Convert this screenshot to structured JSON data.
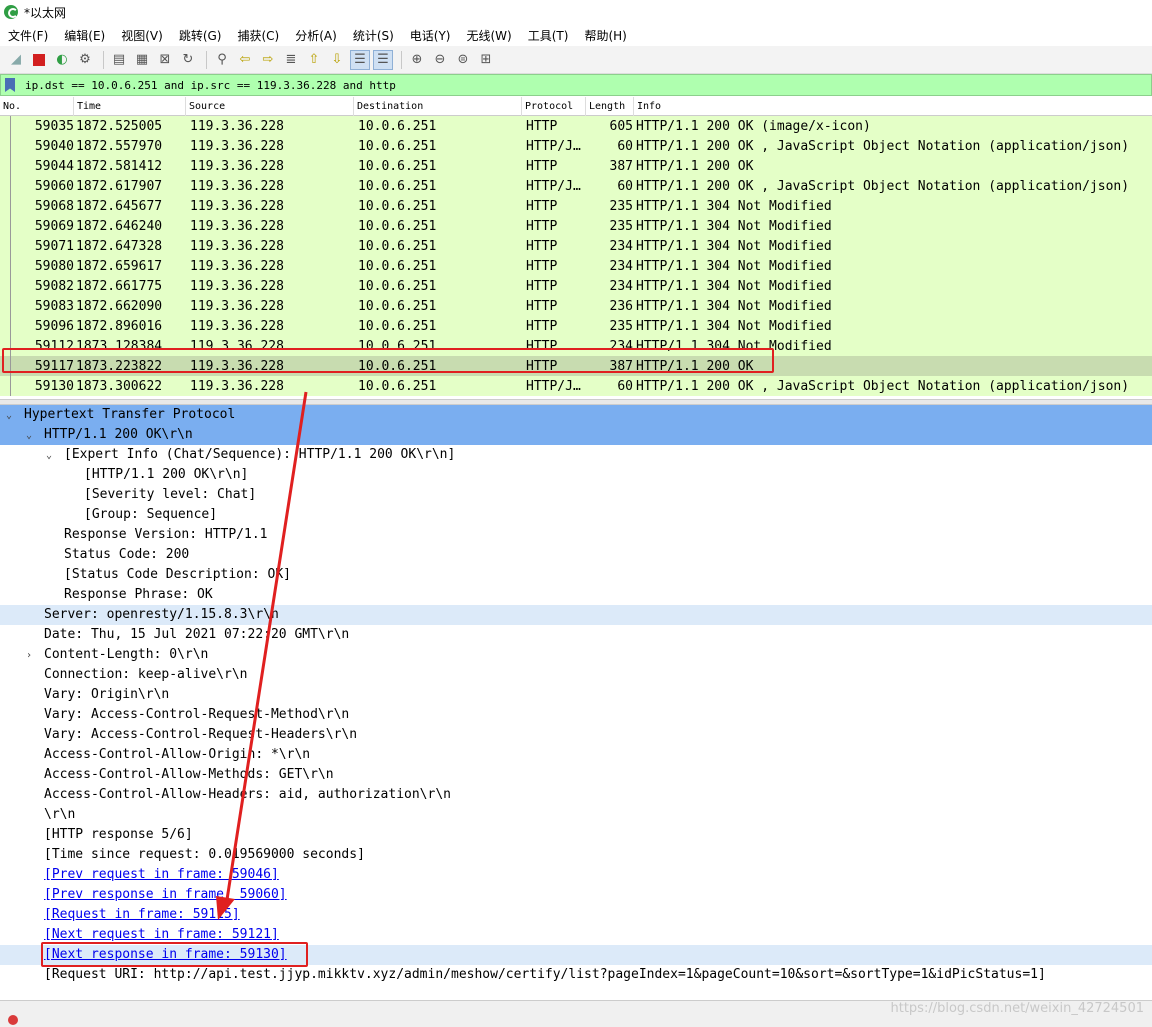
{
  "window": {
    "title": "*以太网"
  },
  "menu": [
    "文件(F)",
    "编辑(E)",
    "视图(V)",
    "跳转(G)",
    "捕获(C)",
    "分析(A)",
    "统计(S)",
    "电话(Y)",
    "无线(W)",
    "工具(T)",
    "帮助(H)"
  ],
  "toolbar": {
    "buttons": [
      "shark-fin-icon",
      "stop-icon",
      "restart-icon",
      "options-icon",
      "open-icon",
      "save-icon",
      "close-file-icon",
      "reload-icon",
      "find-icon",
      "back-icon",
      "forward-icon",
      "goto-icon",
      "first-icon",
      "last-icon",
      "autoscroll-icon",
      "colorize-icon",
      "zoom-in-icon",
      "zoom-out-icon",
      "zoom-normal-icon",
      "resize-columns-icon"
    ]
  },
  "filter": {
    "text": "ip.dst == 10.0.6.251 and ip.src == 119.3.36.228 and  http"
  },
  "packet_list": {
    "columns": [
      "No.",
      "Time",
      "Source",
      "Destination",
      "Protocol",
      "Length",
      "Info"
    ],
    "rows": [
      {
        "no": "59035",
        "time": "1872.525005",
        "src": "119.3.36.228",
        "dst": "10.0.6.251",
        "proto": "HTTP",
        "len": "605",
        "info": "HTTP/1.1 200 OK  (image/x-icon)"
      },
      {
        "no": "59040",
        "time": "1872.557970",
        "src": "119.3.36.228",
        "dst": "10.0.6.251",
        "proto": "HTTP/J…",
        "len": "60",
        "info": "HTTP/1.1 200 OK , JavaScript Object Notation (application/json)"
      },
      {
        "no": "59044",
        "time": "1872.581412",
        "src": "119.3.36.228",
        "dst": "10.0.6.251",
        "proto": "HTTP",
        "len": "387",
        "info": "HTTP/1.1 200 OK"
      },
      {
        "no": "59060",
        "time": "1872.617907",
        "src": "119.3.36.228",
        "dst": "10.0.6.251",
        "proto": "HTTP/J…",
        "len": "60",
        "info": "HTTP/1.1 200 OK , JavaScript Object Notation (application/json)"
      },
      {
        "no": "59068",
        "time": "1872.645677",
        "src": "119.3.36.228",
        "dst": "10.0.6.251",
        "proto": "HTTP",
        "len": "235",
        "info": "HTTP/1.1 304 Not Modified"
      },
      {
        "no": "59069",
        "time": "1872.646240",
        "src": "119.3.36.228",
        "dst": "10.0.6.251",
        "proto": "HTTP",
        "len": "235",
        "info": "HTTP/1.1 304 Not Modified"
      },
      {
        "no": "59071",
        "time": "1872.647328",
        "src": "119.3.36.228",
        "dst": "10.0.6.251",
        "proto": "HTTP",
        "len": "234",
        "info": "HTTP/1.1 304 Not Modified"
      },
      {
        "no": "59080",
        "time": "1872.659617",
        "src": "119.3.36.228",
        "dst": "10.0.6.251",
        "proto": "HTTP",
        "len": "234",
        "info": "HTTP/1.1 304 Not Modified"
      },
      {
        "no": "59082",
        "time": "1872.661775",
        "src": "119.3.36.228",
        "dst": "10.0.6.251",
        "proto": "HTTP",
        "len": "234",
        "info": "HTTP/1.1 304 Not Modified"
      },
      {
        "no": "59083",
        "time": "1872.662090",
        "src": "119.3.36.228",
        "dst": "10.0.6.251",
        "proto": "HTTP",
        "len": "236",
        "info": "HTTP/1.1 304 Not Modified"
      },
      {
        "no": "59096",
        "time": "1872.896016",
        "src": "119.3.36.228",
        "dst": "10.0.6.251",
        "proto": "HTTP",
        "len": "235",
        "info": "HTTP/1.1 304 Not Modified"
      },
      {
        "no": "59112",
        "time": "1873.128384",
        "src": "119.3.36.228",
        "dst": "10.0.6.251",
        "proto": "HTTP",
        "len": "234",
        "info": "HTTP/1.1 304 Not Modified"
      },
      {
        "no": "59117",
        "time": "1873.223822",
        "src": "119.3.36.228",
        "dst": "10.0.6.251",
        "proto": "HTTP",
        "len": "387",
        "info": "HTTP/1.1 200 OK"
      },
      {
        "no": "59130",
        "time": "1873.300622",
        "src": "119.3.36.228",
        "dst": "10.0.6.251",
        "proto": "HTTP/J…",
        "len": "60",
        "info": "HTTP/1.1 200 OK , JavaScript Object Notation (application/json)"
      }
    ]
  },
  "detail": {
    "lines": [
      {
        "text": "Hypertext Transfer Protocol",
        "chev": "v",
        "link": false
      },
      {
        "text": "HTTP/1.1 200 OK\\r\\n",
        "chev": "v",
        "link": false
      },
      {
        "text": "[Expert Info (Chat/Sequence): HTTP/1.1 200 OK\\r\\n]",
        "chev": "v",
        "link": false
      },
      {
        "text": "[HTTP/1.1 200 OK\\r\\n]",
        "chev": "",
        "link": false
      },
      {
        "text": "[Severity level: Chat]",
        "chev": "",
        "link": false
      },
      {
        "text": "[Group: Sequence]",
        "chev": "",
        "link": false
      },
      {
        "text": "Response Version: HTTP/1.1",
        "chev": "",
        "link": false
      },
      {
        "text": "Status Code: 200",
        "chev": "",
        "link": false
      },
      {
        "text": "[Status Code Description: OK]",
        "chev": "",
        "link": false
      },
      {
        "text": "Response Phrase: OK",
        "chev": "",
        "link": false
      },
      {
        "text": "Server: openresty/1.15.8.3\\r\\n",
        "chev": "",
        "link": false
      },
      {
        "text": "Date: Thu, 15 Jul 2021 07:22:20 GMT\\r\\n",
        "chev": "",
        "link": false
      },
      {
        "text": "Content-Length: 0\\r\\n",
        "chev": ">",
        "link": false
      },
      {
        "text": "Connection: keep-alive\\r\\n",
        "chev": "",
        "link": false
      },
      {
        "text": "Vary: Origin\\r\\n",
        "chev": "",
        "link": false
      },
      {
        "text": "Vary: Access-Control-Request-Method\\r\\n",
        "chev": "",
        "link": false
      },
      {
        "text": "Vary: Access-Control-Request-Headers\\r\\n",
        "chev": "",
        "link": false
      },
      {
        "text": "Access-Control-Allow-Origin: *\\r\\n",
        "chev": "",
        "link": false
      },
      {
        "text": "Access-Control-Allow-Methods: GET\\r\\n",
        "chev": "",
        "link": false
      },
      {
        "text": "Access-Control-Allow-Headers: aid, authorization\\r\\n",
        "chev": "",
        "link": false
      },
      {
        "text": "\\r\\n",
        "chev": "",
        "link": false
      },
      {
        "text": "[HTTP response 5/6]",
        "chev": "",
        "link": false
      },
      {
        "text": "[Time since request: 0.019569000 seconds]",
        "chev": "",
        "link": false
      },
      {
        "text": "[Prev request in frame: 59046]",
        "chev": "",
        "link": true
      },
      {
        "text": "[Prev response in frame: 59060]",
        "chev": "",
        "link": true
      },
      {
        "text": "[Request in frame: 59115]",
        "chev": "",
        "link": true
      },
      {
        "text": "[Next request in frame: 59121]",
        "chev": "",
        "link": true
      },
      {
        "text": "[Next response in frame: 59130]",
        "chev": "",
        "link": true
      },
      {
        "text": "[Request URI: http://api.test.jjyp.mikktv.xyz/admin/meshow/certify/list?pageIndex=1&pageCount=10&sort=&sortType=1&idPicStatus=1]",
        "chev": "",
        "link": false
      }
    ]
  },
  "watermark": "https://blog.csdn.net/weixin_42724501",
  "colors": {
    "row_bg": "#e4ffc7",
    "selected_row": "#c8dcb0",
    "filter_bg": "#afffaf",
    "highlight": "#7aaef0",
    "annotation": "#e02020"
  }
}
